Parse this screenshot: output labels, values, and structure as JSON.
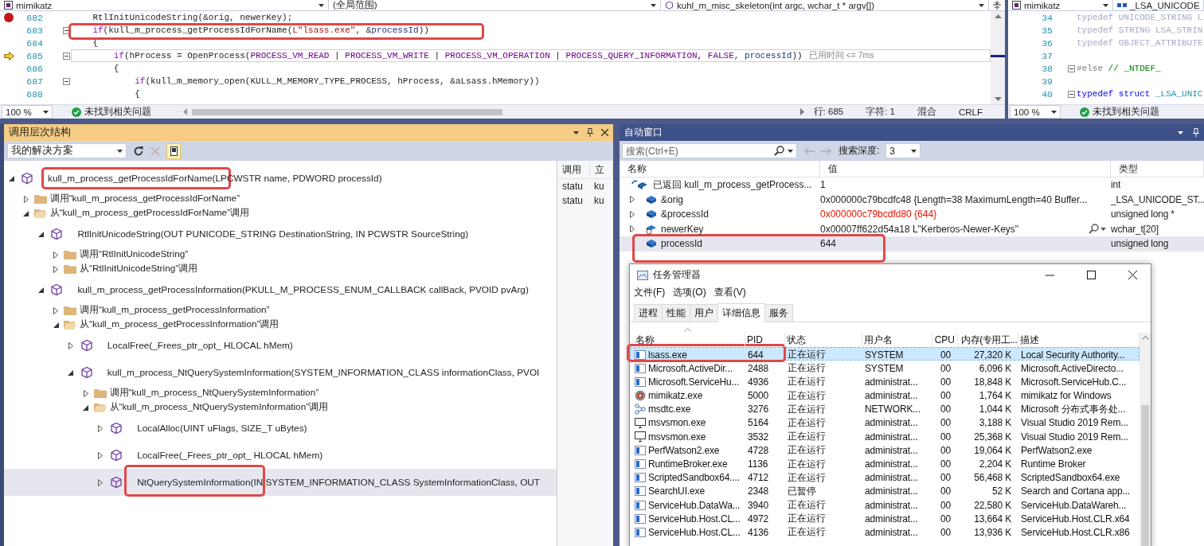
{
  "editor_main": {
    "nav": [
      {
        "text": "mimikatz",
        "kind": "project"
      },
      {
        "text": "(全局范围)",
        "kind": "scope"
      },
      {
        "text": "kuhl_m_misc_skeleton(int argc, wchar_t * argv[])",
        "kind": "method"
      }
    ],
    "lines": [
      {
        "number": "682",
        "breakpoint": true,
        "current": false,
        "outline": false,
        "tokens": [
          {
            "kind": "plain",
            "text": "    RtlInitUnicodeString(&orig, newerKey);"
          }
        ]
      },
      {
        "number": "683",
        "breakpoint": false,
        "current": false,
        "outline": true,
        "tokens": [
          {
            "kind": "keyword",
            "text": "    if"
          },
          {
            "kind": "plain",
            "text": "(kull_m_process_getProcessIdForName("
          },
          {
            "kind": "string",
            "text": "L\"lsass.exe\""
          },
          {
            "kind": "plain",
            "text": ", &"
          },
          {
            "kind": "param",
            "text": "processId"
          },
          {
            "kind": "plain",
            "text": "))"
          }
        ]
      },
      {
        "number": "684",
        "breakpoint": false,
        "current": false,
        "outline": false,
        "tokens": [
          {
            "kind": "plain",
            "text": "    {"
          }
        ]
      },
      {
        "number": "685",
        "breakpoint": false,
        "current": true,
        "outline": true,
        "hint": "已用时间 <= 7ms",
        "tokens": [
          {
            "kind": "keyword",
            "text": "        if"
          },
          {
            "kind": "plain",
            "text": "(hProcess = OpenProcess("
          },
          {
            "kind": "macro",
            "text": "PROCESS_VM_READ"
          },
          {
            "kind": "plain",
            "text": " | "
          },
          {
            "kind": "macro",
            "text": "PROCESS_VM_WRITE"
          },
          {
            "kind": "plain",
            "text": " | "
          },
          {
            "kind": "macro",
            "text": "PROCESS_VM_OPERATION"
          },
          {
            "kind": "plain",
            "text": " | "
          },
          {
            "kind": "macro",
            "text": "PROCESS_QUERY_INFORMATION"
          },
          {
            "kind": "plain",
            "text": ", "
          },
          {
            "kind": "macro",
            "text": "FALSE"
          },
          {
            "kind": "plain",
            "text": ", "
          },
          {
            "kind": "param",
            "text": "processId"
          },
          {
            "kind": "plain",
            "text": "))"
          }
        ]
      },
      {
        "number": "686",
        "breakpoint": false,
        "current": false,
        "outline": false,
        "tokens": [
          {
            "kind": "plain",
            "text": "        {"
          }
        ]
      },
      {
        "number": "687",
        "breakpoint": false,
        "current": false,
        "outline": true,
        "tokens": [
          {
            "kind": "keyword",
            "text": "            if"
          },
          {
            "kind": "plain",
            "text": "(kull_m_memory_open(KULL_M_MEMORY_TYPE_PROCESS, hProcess, &aLsass.hMemory))"
          }
        ]
      },
      {
        "number": "688",
        "breakpoint": false,
        "current": false,
        "outline": false,
        "tokens": [
          {
            "kind": "plain",
            "text": "            {"
          }
        ]
      }
    ],
    "status": {
      "zoom": "100 %",
      "issues": "未找到相关问题",
      "position": [
        "行: 685",
        "字符: 1",
        "混合",
        "CRLF"
      ]
    }
  },
  "editor_side": {
    "nav": [
      {
        "text": "mimikatz",
        "kind": "project"
      },
      {
        "text": "_LSA_UNICODE",
        "kind": "struct"
      }
    ],
    "lines": [
      {
        "number": "34",
        "breakpoint": false,
        "current": false,
        "outline": false,
        "tokens": [
          {
            "kind": "inactive",
            "text": "typedef UNICODE_STRING L"
          }
        ]
      },
      {
        "number": "35",
        "breakpoint": false,
        "current": false,
        "outline": false,
        "tokens": [
          {
            "kind": "inactive",
            "text": "typedef STRING LSA_STRIN"
          }
        ]
      },
      {
        "number": "36",
        "breakpoint": false,
        "current": false,
        "outline": false,
        "tokens": [
          {
            "kind": "inactive",
            "text": "typedef OBJECT_ATTRIBUTE"
          }
        ]
      },
      {
        "number": "37",
        "breakpoint": false,
        "current": false,
        "outline": false
      },
      {
        "number": "38",
        "breakpoint": false,
        "current": false,
        "outline": true,
        "tokens": [
          {
            "kind": "preproc",
            "text": "#else"
          },
          {
            "kind": "comment",
            "text": " // _NTDEF_"
          }
        ]
      },
      {
        "number": "39",
        "breakpoint": false,
        "current": false,
        "outline": false
      },
      {
        "number": "40",
        "breakpoint": false,
        "current": false,
        "outline": true,
        "tokens": [
          {
            "kind": "blue",
            "text": "typedef struct"
          },
          {
            "kind": "type",
            "text": " _LSA_UNIC"
          }
        ]
      }
    ],
    "status": {
      "zoom": "100 %",
      "issues": "未找到相关问题"
    }
  },
  "call_hierarchy": {
    "title": "调用层次结构",
    "scope": "我的解决方案",
    "details_pane": true,
    "tree": [
      {
        "kind": "method",
        "text": "kull_m_process_getProcessIdForName(LPCWSTR name, PDWORD processId)",
        "expanded": true,
        "selected": false,
        "children": [
          {
            "kind": "folder",
            "text": "调用“kull_m_process_getProcessIdForName”",
            "expanded": false,
            "selected": false
          },
          {
            "kind": "folder",
            "text": "从“kull_m_process_getProcessIdForName”调用",
            "expanded": true,
            "selected": false,
            "children": [
              {
                "kind": "method",
                "text": "RtlInitUnicodeString(OUT PUNICODE_STRING DestinationString, IN PCWSTR SourceString)",
                "expanded": true,
                "selected": false,
                "children": [
                  {
                    "kind": "folder",
                    "text": "调用“RtlInitUnicodeString”",
                    "expanded": false,
                    "selected": false
                  },
                  {
                    "kind": "folder",
                    "text": "从“RtlInitUnicodeString”调用",
                    "expanded": false,
                    "selected": false
                  }
                ]
              },
              {
                "kind": "method",
                "text": "kull_m_process_getProcessInformation(PKULL_M_PROCESS_ENUM_CALLBACK callBack, PVOID pvArg)",
                "expanded": true,
                "selected": false,
                "children": [
                  {
                    "kind": "folder",
                    "text": "调用“kull_m_process_getProcessInformation”",
                    "expanded": false,
                    "selected": false
                  },
                  {
                    "kind": "folder",
                    "text": "从“kull_m_process_getProcessInformation”调用",
                    "expanded": true,
                    "selected": false,
                    "children": [
                      {
                        "kind": "method",
                        "text": "LocalFree(_Frees_ptr_opt_ HLOCAL hMem)",
                        "expanded": false,
                        "selected": false
                      },
                      {
                        "kind": "method",
                        "text": "kull_m_process_NtQuerySystemInformation(SYSTEM_INFORMATION_CLASS informationClass, PVOI",
                        "expanded": true,
                        "selected": false,
                        "children": [
                          {
                            "kind": "folder",
                            "text": "调用“kull_m_process_NtQuerySystemInformation”",
                            "expanded": false,
                            "selected": false
                          },
                          {
                            "kind": "folder",
                            "text": "从“kull_m_process_NtQuerySystemInformation”调用",
                            "expanded": true,
                            "selected": false,
                            "children": [
                              {
                                "kind": "method",
                                "text": "LocalAlloc(UINT uFlags, SIZE_T uBytes)",
                                "expanded": false,
                                "selected": false
                              },
                              {
                                "kind": "method",
                                "text": "LocalFree(_Frees_ptr_opt_ HLOCAL hMem)",
                                "expanded": false,
                                "selected": false
                              },
                              {
                                "kind": "method",
                                "text": "NtQuerySystemInformation(IN SYSTEM_INFORMATION_CLASS SystemInformationClass, OUT",
                                "expanded": false,
                                "selected": true
                              }
                            ]
                          }
                        ]
                      }
                    ]
                  }
                ]
              }
            ]
          }
        ]
      }
    ],
    "details": {
      "columns": [
        "调用",
        "立"
      ],
      "rows": [
        [
          "statu",
          "ku"
        ],
        [
          "statu",
          "ku"
        ]
      ]
    }
  },
  "autos": {
    "title": "自动窗口",
    "search": {
      "placeholder": "搜索(Ctrl+E)"
    },
    "depth_label": "搜索深度:",
    "depth": "3",
    "columns": [
      "名称",
      "值",
      "类型"
    ],
    "rows": [
      {
        "kind": "returned",
        "name": "已返回 kull_m_process_getProcess...",
        "value": "1",
        "type": "int",
        "expandable": false,
        "changed": false,
        "inspect": false,
        "selected": false
      },
      {
        "kind": "local",
        "name": "&orig",
        "value": "0x000000c79bcdfc48 {Length=38 MaximumLength=40 Buffer...",
        "type": "_LSA_UNICODE_ST...",
        "expandable": true,
        "changed": false,
        "inspect": false,
        "selected": false
      },
      {
        "kind": "local",
        "name": "&processId",
        "value": "0x000000c79bcdfd80 {644}",
        "type": "unsigned long *",
        "expandable": true,
        "changed": true,
        "inspect": false,
        "selected": false
      },
      {
        "kind": "static",
        "name": "newerKey",
        "value": "0x00007ff622d54a18 L\"Kerberos-Newer-Keys\"",
        "type": "wchar_t[20]",
        "expandable": true,
        "changed": false,
        "inspect": true,
        "selected": false
      },
      {
        "kind": "local",
        "name": "processId",
        "value": "644",
        "type": "unsigned long",
        "expandable": false,
        "changed": false,
        "inspect": false,
        "selected": true
      }
    ]
  },
  "task_manager": {
    "title": "任务管理器",
    "menu": [
      "文件(F)",
      "选项(O)",
      "查看(V)"
    ],
    "tabs": [
      {
        "label": "进程",
        "selected": false
      },
      {
        "label": "性能",
        "selected": false
      },
      {
        "label": "用户",
        "selected": false
      },
      {
        "label": "详细信息",
        "selected": true
      },
      {
        "label": "服务",
        "selected": false
      }
    ],
    "columns": [
      "名称",
      "PID",
      "状态",
      "用户名",
      "CPU",
      "内存(专用工...",
      "描述"
    ],
    "rows": [
      {
        "kind": "app",
        "name": "lsass.exe",
        "pid": "644",
        "status": "正在运行",
        "user": "SYSTEM",
        "cpu": "00",
        "memory": "27,320 K",
        "description": "Local Security Authority...",
        "selected": true
      },
      {
        "kind": "app",
        "name": "Microsoft.ActiveDir...",
        "pid": "2488",
        "status": "正在运行",
        "user": "SYSTEM",
        "cpu": "00",
        "memory": "6,096 K",
        "description": "Microsoft.ActiveDirecto...",
        "selected": false
      },
      {
        "kind": "app",
        "name": "Microsoft.ServiceHu...",
        "pid": "4936",
        "status": "正在运行",
        "user": "administrat...",
        "cpu": "00",
        "memory": "18,848 K",
        "description": "Microsoft.ServiceHub.C...",
        "selected": false
      },
      {
        "kind": "disc",
        "name": "mimikatz.exe",
        "pid": "5000",
        "status": "正在运行",
        "user": "administrat...",
        "cpu": "00",
        "memory": "1,764 K",
        "description": "mimikatz for Windows",
        "selected": false
      },
      {
        "kind": "nodes",
        "name": "msdtc.exe",
        "pid": "3276",
        "status": "正在运行",
        "user": "NETWORK...",
        "cpu": "00",
        "memory": "1,044 K",
        "description": "Microsoft 分布式事务处...",
        "selected": false
      },
      {
        "kind": "monitor",
        "name": "msvsmon.exe",
        "pid": "5164",
        "status": "正在运行",
        "user": "administrat...",
        "cpu": "00",
        "memory": "3,188 K",
        "description": "Visual Studio 2019 Rem...",
        "selected": false
      },
      {
        "kind": "monitor",
        "name": "msvsmon.exe",
        "pid": "3532",
        "status": "正在运行",
        "user": "administrat...",
        "cpu": "00",
        "memory": "25,368 K",
        "description": "Visual Studio 2019 Rem...",
        "selected": false
      },
      {
        "kind": "app",
        "name": "PerfWatson2.exe",
        "pid": "4728",
        "status": "正在运行",
        "user": "administrat...",
        "cpu": "00",
        "memory": "19,064 K",
        "description": "PerfWatson2.exe",
        "selected": false
      },
      {
        "kind": "app",
        "name": "RuntimeBroker.exe",
        "pid": "1136",
        "status": "正在运行",
        "user": "administrat...",
        "cpu": "00",
        "memory": "2,204 K",
        "description": "Runtime Broker",
        "selected": false
      },
      {
        "kind": "app",
        "name": "ScriptedSandbox64....",
        "pid": "4712",
        "status": "正在运行",
        "user": "administrat...",
        "cpu": "00",
        "memory": "56,468 K",
        "description": "ScriptedSandbox64.exe",
        "selected": false
      },
      {
        "kind": "app",
        "name": "SearchUI.exe",
        "pid": "2348",
        "status": "已暂停",
        "user": "administrat...",
        "cpu": "00",
        "memory": "52 K",
        "description": "Search and Cortana app...",
        "selected": false
      },
      {
        "kind": "app",
        "name": "ServiceHub.DataWa...",
        "pid": "3940",
        "status": "正在运行",
        "user": "administrat...",
        "cpu": "00",
        "memory": "22,580 K",
        "description": "ServiceHub.DataWareh...",
        "selected": false
      },
      {
        "kind": "app",
        "name": "ServiceHub.Host.CL...",
        "pid": "4972",
        "status": "正在运行",
        "user": "administrat...",
        "cpu": "00",
        "memory": "13,664 K",
        "description": "ServiceHub.Host.CLR.x64",
        "selected": false
      },
      {
        "kind": "app",
        "name": "ServiceHub.Host.CL...",
        "pid": "4136",
        "status": "正在运行",
        "user": "administrat...",
        "cpu": "00",
        "memory": "13,936 K",
        "description": "ServiceHub.Host.CLR.x86",
        "selected": false
      }
    ]
  }
}
